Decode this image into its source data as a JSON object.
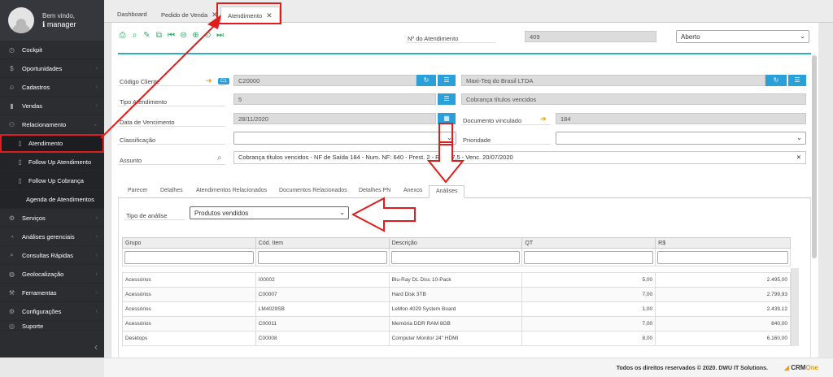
{
  "user": {
    "welcome": "Bem vindo,",
    "name": "manager"
  },
  "menu": [
    {
      "label": "Cockpit",
      "icon": "dashboard-icon"
    },
    {
      "label": "Oportunidades",
      "icon": "dollar-icon"
    },
    {
      "label": "Cadastros",
      "icon": "user-icon"
    },
    {
      "label": "Vendas",
      "icon": "chart-icon"
    },
    {
      "label": "Relacionamento",
      "icon": "handshake-icon"
    },
    {
      "label": "Atendimento",
      "icon": "document-icon"
    },
    {
      "label": "Follow Up Atendimento",
      "icon": "document-icon"
    },
    {
      "label": "Follow Up Cobrança",
      "icon": "document-icon"
    },
    {
      "label": "Agenda de Atendimentos",
      "icon": ""
    },
    {
      "label": "Serviços",
      "icon": "gear-icon"
    },
    {
      "label": "Análises gerenciais",
      "icon": "pie-icon"
    },
    {
      "label": "Consultas Rápidas",
      "icon": "search-icon"
    },
    {
      "label": "Geolocalização",
      "icon": "globe-icon"
    },
    {
      "label": "Ferramentas",
      "icon": "wrench-icon"
    },
    {
      "label": "Configurações",
      "icon": "cog-icon"
    },
    {
      "label": "Suporte",
      "icon": "support-icon"
    }
  ],
  "tabs": [
    {
      "label": "Dashboard"
    },
    {
      "label": "Pedido de Venda"
    },
    {
      "label": "Atendimento"
    }
  ],
  "form": {
    "numero_label": "Nº do Atendimento",
    "numero_value": "409",
    "status": "Aberto",
    "cliente_label": "Código Cliente",
    "cliente_badge": "C1",
    "cliente_code": "C20000",
    "cliente_name": "Maxi-Teq do Brasil LTDA",
    "tipo_label": "Tipo Atendimento",
    "tipo_code": "5",
    "tipo_name": "Cobrança títulos vencidos",
    "venc_label": "Data de Vencimento",
    "venc_value": "28/11/2020",
    "doc_label": "Documento vinculado",
    "doc_value": "184",
    "class_label": "Classificação",
    "prio_label": "Prioridade",
    "assunto_label": "Assunto",
    "assunto_value": "Cobrança títulos vencidos - NF de Saída 184 - Num. NF: 640 - Prest. 2 - R$ 517,5 - Venc. 20/07/2020"
  },
  "inner_tabs": [
    "Parecer",
    "Detalhes",
    "Atendimentos Relacionados",
    "Documentos Relacionados",
    "Detalhes PN",
    "Anexos",
    "Análises"
  ],
  "analysis": {
    "label": "Tipo de análise",
    "value": "Produtos vendidos"
  },
  "grid": {
    "headers": [
      "Grupo",
      "Cód. Item",
      "Descrição",
      "QT",
      "R$"
    ],
    "rows": [
      [
        "Acessórios",
        "I00002",
        "Blu-Ray DL Disc 10-Pack",
        "5,00",
        "2.495,00"
      ],
      [
        "Acessórios",
        "C00007",
        "Hard Disk 3TB",
        "7,00",
        "2.799,93"
      ],
      [
        "Acessórios",
        "LM4029SB",
        "LeMon 4029 System Board",
        "1,00",
        "2.439,12"
      ],
      [
        "Acessórios",
        "C00011",
        "Memória DDR RAM 8GB",
        "7,00",
        "840,00"
      ],
      [
        "Desktops",
        "C00008",
        "Computer Monitor 24\" HDMI",
        "8,00",
        "6.160,00"
      ]
    ]
  },
  "footer": {
    "text": "Todos os direitos reservados © 2020.  DWU IT Solutions.",
    "logo_crm": "CRM",
    "logo_one": "One"
  }
}
